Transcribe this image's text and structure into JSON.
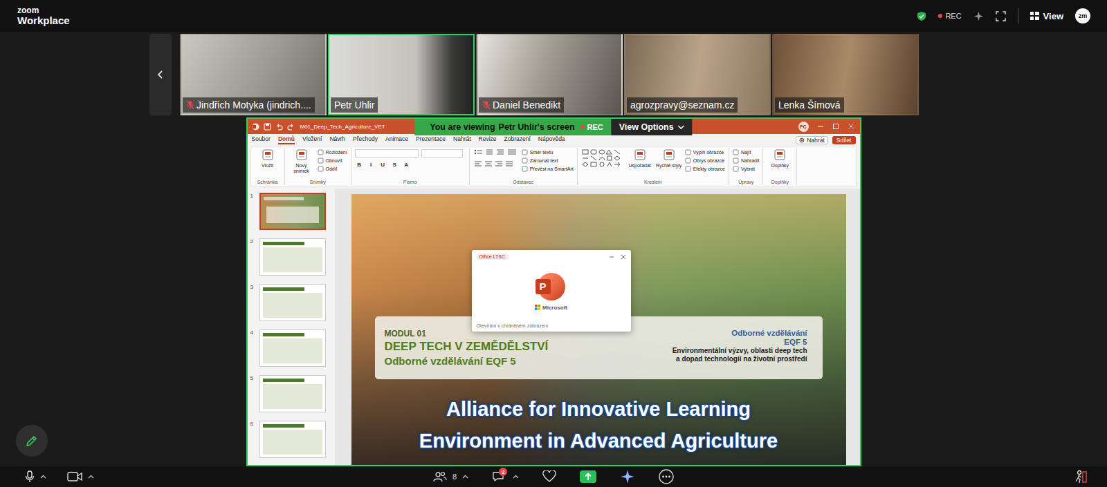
{
  "topbar": {
    "logo_top": "zoom",
    "logo_bottom": "Workplace",
    "recording": true,
    "rec_label": "REC",
    "view_label": "View",
    "avatar": "zm"
  },
  "participants": [
    {
      "name": "Jindřich Motyka (jindrich....",
      "muted": true,
      "speaking": false
    },
    {
      "name": "Petr Uhlir",
      "muted": false,
      "speaking": true
    },
    {
      "name": "Daniel Benedikt",
      "muted": true,
      "speaking": false
    },
    {
      "name": "agrozpravy@seznam.cz",
      "muted": false,
      "speaking": false
    },
    {
      "name": "Lenka Šímová",
      "muted": false,
      "speaking": false
    }
  ],
  "share_banner": {
    "viewing": "You are viewing",
    "presenter": "Petr Uhlir's screen",
    "rec_label": "REC",
    "options": "View Options"
  },
  "powerpoint": {
    "title": "M01_Deep_Tech_Agriculture_VET",
    "user": "FC",
    "menu": [
      {
        "label": "Soubor",
        "selected": false
      },
      {
        "label": "Domů",
        "selected": true
      },
      {
        "label": "Vložení",
        "selected": false
      },
      {
        "label": "Návrh",
        "selected": false
      },
      {
        "label": "Přechody",
        "selected": false
      },
      {
        "label": "Animace",
        "selected": false
      },
      {
        "label": "Prezentace",
        "selected": false
      },
      {
        "label": "Nahrát",
        "selected": false
      },
      {
        "label": "Revize",
        "selected": false
      },
      {
        "label": "Zobrazení",
        "selected": false
      },
      {
        "label": "Nápověda",
        "selected": false
      }
    ],
    "record": "Nahrát",
    "share": "Sdílet",
    "ribbon": [
      {
        "label": "Schránka",
        "items": [
          {
            "text": "Vložit",
            "kind": "large"
          }
        ]
      },
      {
        "label": "Snímky",
        "items": [
          {
            "text": "Nový snímek",
            "kind": "large"
          },
          {
            "text": "Rozložení",
            "kind": "small"
          },
          {
            "text": "Obnovit",
            "kind": "small"
          },
          {
            "text": "Oddíl",
            "kind": "small"
          }
        ]
      },
      {
        "label": "Písmo",
        "items": [
          {
            "kind": "field"
          },
          {
            "kind": "field"
          },
          {
            "text": "B",
            "kind": "format"
          },
          {
            "text": "I",
            "kind": "format"
          },
          {
            "text": "U",
            "kind": "format"
          },
          {
            "text": "S",
            "kind": "format"
          },
          {
            "text": "A",
            "kind": "format"
          }
        ]
      },
      {
        "label": "Odstavec",
        "items": [
          {
            "kind": "para"
          },
          {
            "text": "Směr textu",
            "kind": "small"
          },
          {
            "text": "Zarovnat text",
            "kind": "small"
          },
          {
            "text": "Převést na SmartArt",
            "kind": "small"
          }
        ]
      },
      {
        "label": "Kreslení",
        "items": [
          {
            "kind": "shapes"
          },
          {
            "text": "Uspořádat",
            "kind": "large"
          },
          {
            "text": "Rychlé styly",
            "kind": "large"
          },
          {
            "text": "Výplň obrazce",
            "kind": "small"
          },
          {
            "text": "Obrys obrazce",
            "kind": "small"
          },
          {
            "text": "Efekty obrazce",
            "kind": "small"
          }
        ]
      },
      {
        "label": "Úpravy",
        "items": [
          {
            "text": "Najít",
            "kind": "small"
          },
          {
            "text": "Nahradit",
            "kind": "small"
          },
          {
            "text": "Vybrat",
            "kind": "small"
          }
        ]
      },
      {
        "label": "Doplňky",
        "items": [
          {
            "text": "Doplňky",
            "kind": "large"
          }
        ]
      }
    ],
    "thumbnails": [
      {
        "number": "1",
        "selected": true
      },
      {
        "number": "2",
        "selected": false
      },
      {
        "number": "3",
        "selected": false
      },
      {
        "number": "4",
        "selected": false
      },
      {
        "number": "5",
        "selected": false
      },
      {
        "number": "6",
        "selected": false
      }
    ]
  },
  "slide": {
    "module": "MODUL 01",
    "title": "DEEP TECH V ZEMĚDĚLSTVÍ",
    "subtitle": "Odborné vzdělávání EQF 5",
    "right_heading": "Odborné vzdělávání",
    "right_level": "EQF 5",
    "right_lines": [
      "Environmentální výzvy, oblasti deep tech",
      "a dopad technologií na životní prostředí"
    ],
    "banner_lines": [
      "Alliance for Innovative Learning",
      "Environment in Advanced Agriculture"
    ]
  },
  "splash": {
    "tag": "Office LTSC",
    "logo_letter": "P",
    "brand": "Microsoft",
    "status": "Otevírání v chráněném zobrazení"
  },
  "toolbar": {
    "participants": "8",
    "chat_badge": "2"
  }
}
